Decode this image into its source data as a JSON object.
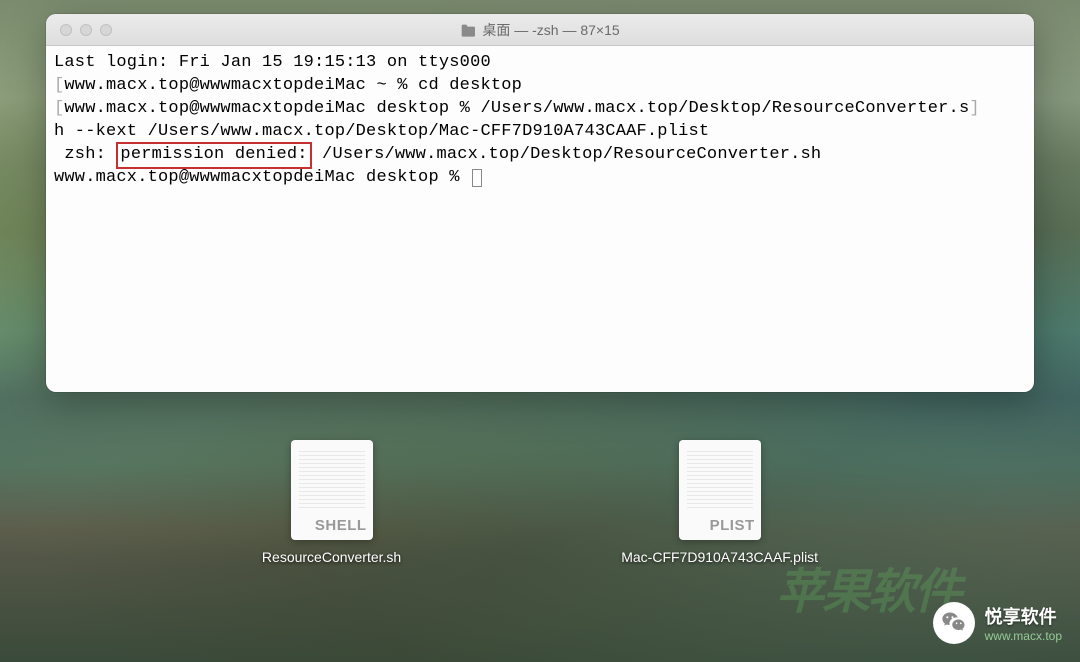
{
  "window": {
    "title": "桌面 — -zsh — 87×15"
  },
  "terminal": {
    "line1": "Last login: Fri Jan 15 19:15:13 on ttys000",
    "line2_pre": "[",
    "line2": "www.macx.top@wwwmacxtopdeiMac ~ % cd desktop",
    "line2_post": "]",
    "line3_pre": "[",
    "line3": "www.macx.top@wwwmacxtopdeiMac desktop % /Users/www.macx.top/Desktop/ResourceConverter.s",
    "line3_post": "]",
    "line4": "h --kext /Users/www.macx.top/Desktop/Mac-CFF7D910A743CAAF.plist",
    "line5_a": " zsh: ",
    "line5_highlight": "permission denied:",
    "line5_b": " /Users/www.macx.top/Desktop/ResourceConverter.sh",
    "line6": "www.macx.top@wwwmacxtopdeiMac desktop % "
  },
  "files": {
    "file1": {
      "type": "SHELL",
      "name": "ResourceConverter.sh"
    },
    "file2": {
      "type": "PLIST",
      "name": "Mac-CFF7D910A743CAAF.plist"
    }
  },
  "watermark": {
    "bg_text": "苹果软件",
    "main": "悦享软件",
    "sub": "www.macx.top"
  }
}
